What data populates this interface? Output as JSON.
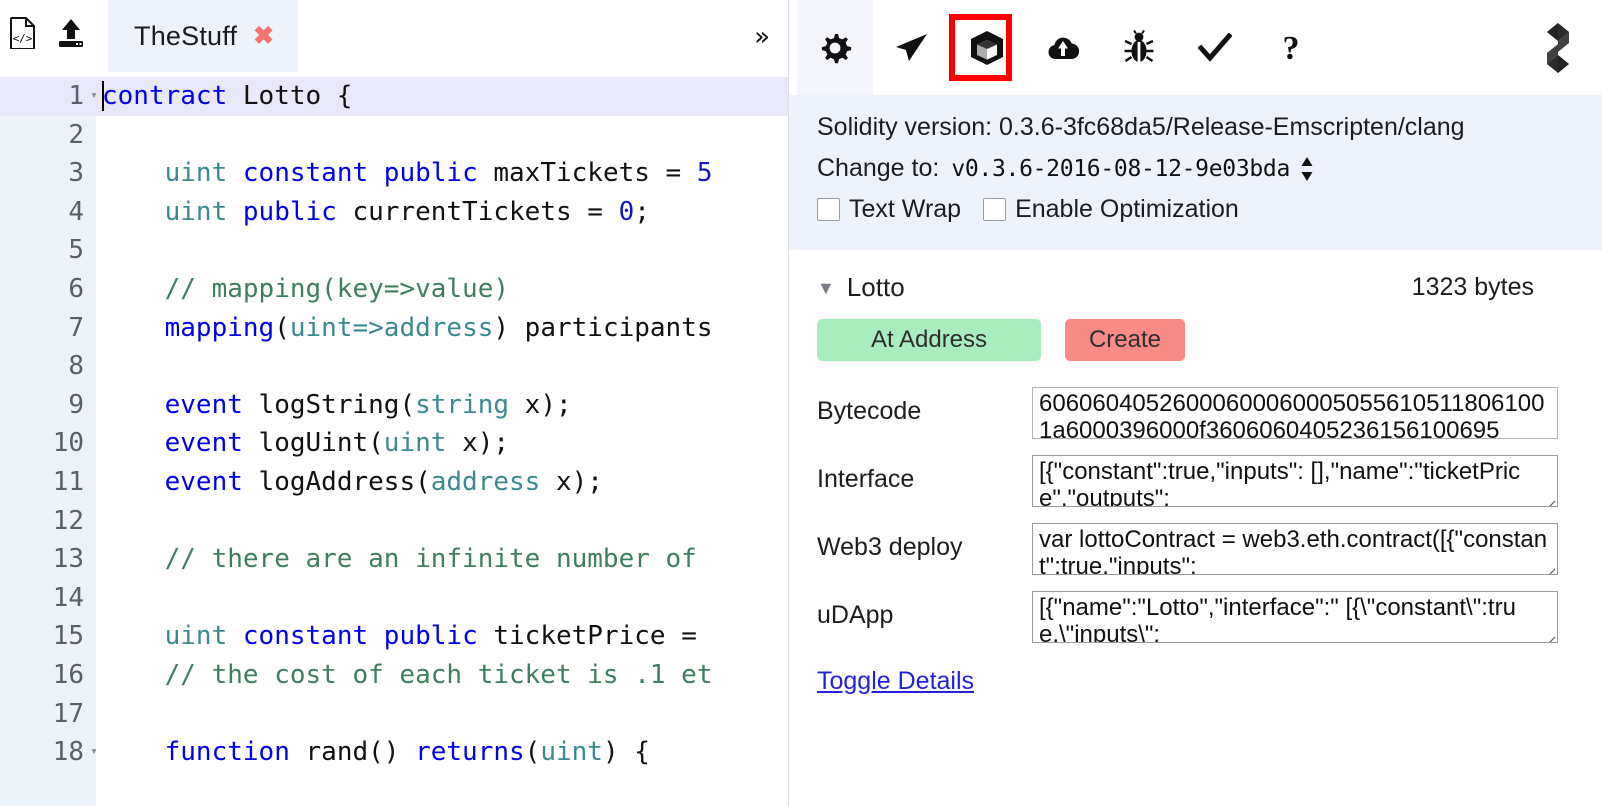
{
  "editor": {
    "toolbar": {
      "new_file_icon": "file-code-icon",
      "upload_icon": "upload-icon",
      "overflow_label": "»"
    },
    "tab": {
      "label": "TheStuff",
      "close_label": "✖"
    },
    "code": [
      {
        "num": "1",
        "fold": true,
        "active": true,
        "tokens": [
          {
            "t": "contract",
            "c": "kw"
          },
          {
            "t": " Lotto {",
            "c": "pln"
          }
        ]
      },
      {
        "num": "2",
        "fold": false,
        "active": false,
        "tokens": []
      },
      {
        "num": "3",
        "fold": false,
        "active": false,
        "tokens": [
          {
            "t": "    ",
            "c": "pln"
          },
          {
            "t": "uint",
            "c": "type"
          },
          {
            "t": " ",
            "c": "pln"
          },
          {
            "t": "constant",
            "c": "kw"
          },
          {
            "t": " ",
            "c": "pln"
          },
          {
            "t": "public",
            "c": "kw"
          },
          {
            "t": " maxTickets = ",
            "c": "pln"
          },
          {
            "t": "5",
            "c": "num"
          }
        ]
      },
      {
        "num": "4",
        "fold": false,
        "active": false,
        "tokens": [
          {
            "t": "    ",
            "c": "pln"
          },
          {
            "t": "uint",
            "c": "type"
          },
          {
            "t": " ",
            "c": "pln"
          },
          {
            "t": "public",
            "c": "kw"
          },
          {
            "t": " currentTickets = ",
            "c": "pln"
          },
          {
            "t": "0",
            "c": "num"
          },
          {
            "t": ";",
            "c": "pln"
          }
        ]
      },
      {
        "num": "5",
        "fold": false,
        "active": false,
        "tokens": []
      },
      {
        "num": "6",
        "fold": false,
        "active": false,
        "tokens": [
          {
            "t": "    ",
            "c": "pln"
          },
          {
            "t": "// mapping(key=>value)",
            "c": "com"
          }
        ]
      },
      {
        "num": "7",
        "fold": false,
        "active": false,
        "tokens": [
          {
            "t": "    ",
            "c": "pln"
          },
          {
            "t": "mapping",
            "c": "kw"
          },
          {
            "t": "(",
            "c": "pln"
          },
          {
            "t": "uint",
            "c": "type"
          },
          {
            "t": "=>",
            "c": "type"
          },
          {
            "t": "address",
            "c": "type"
          },
          {
            "t": ") participants",
            "c": "pln"
          }
        ]
      },
      {
        "num": "8",
        "fold": false,
        "active": false,
        "tokens": []
      },
      {
        "num": "9",
        "fold": false,
        "active": false,
        "tokens": [
          {
            "t": "    ",
            "c": "pln"
          },
          {
            "t": "event",
            "c": "kw"
          },
          {
            "t": " logString(",
            "c": "pln"
          },
          {
            "t": "string",
            "c": "type"
          },
          {
            "t": " x);",
            "c": "pln"
          }
        ]
      },
      {
        "num": "10",
        "fold": false,
        "active": false,
        "tokens": [
          {
            "t": "    ",
            "c": "pln"
          },
          {
            "t": "event",
            "c": "kw"
          },
          {
            "t": " logUint(",
            "c": "pln"
          },
          {
            "t": "uint",
            "c": "type"
          },
          {
            "t": " x);",
            "c": "pln"
          }
        ]
      },
      {
        "num": "11",
        "fold": false,
        "active": false,
        "tokens": [
          {
            "t": "    ",
            "c": "pln"
          },
          {
            "t": "event",
            "c": "kw"
          },
          {
            "t": " logAddress(",
            "c": "pln"
          },
          {
            "t": "address",
            "c": "type"
          },
          {
            "t": " x);",
            "c": "pln"
          }
        ]
      },
      {
        "num": "12",
        "fold": false,
        "active": false,
        "tokens": []
      },
      {
        "num": "13",
        "fold": false,
        "active": false,
        "tokens": [
          {
            "t": "    ",
            "c": "pln"
          },
          {
            "t": "// there are an infinite number of",
            "c": "com"
          }
        ]
      },
      {
        "num": "14",
        "fold": false,
        "active": false,
        "tokens": []
      },
      {
        "num": "15",
        "fold": false,
        "active": false,
        "tokens": [
          {
            "t": "    ",
            "c": "pln"
          },
          {
            "t": "uint",
            "c": "type"
          },
          {
            "t": " ",
            "c": "pln"
          },
          {
            "t": "constant",
            "c": "kw"
          },
          {
            "t": " ",
            "c": "pln"
          },
          {
            "t": "public",
            "c": "kw"
          },
          {
            "t": " ticketPrice = ",
            "c": "pln"
          }
        ]
      },
      {
        "num": "16",
        "fold": false,
        "active": false,
        "tokens": [
          {
            "t": "    ",
            "c": "pln"
          },
          {
            "t": "// the cost of each ticket is .1 et",
            "c": "com"
          }
        ]
      },
      {
        "num": "17",
        "fold": false,
        "active": false,
        "tokens": []
      },
      {
        "num": "18",
        "fold": true,
        "active": false,
        "tokens": [
          {
            "t": "    ",
            "c": "pln"
          },
          {
            "t": "function",
            "c": "kw"
          },
          {
            "t": " rand() ",
            "c": "pln"
          },
          {
            "t": "returns",
            "c": "kw"
          },
          {
            "t": "(",
            "c": "pln"
          },
          {
            "t": "uint",
            "c": "type"
          },
          {
            "t": ") {",
            "c": "pln"
          }
        ]
      }
    ]
  },
  "panel": {
    "tabs": [
      {
        "name": "settings",
        "icon": "gear-icon",
        "active": true
      },
      {
        "name": "run",
        "icon": "paper-plane-icon",
        "active": false
      },
      {
        "name": "compile",
        "icon": "cube-icon",
        "active": false,
        "highlighted": true
      },
      {
        "name": "publish",
        "icon": "cloud-upload-icon",
        "active": false
      },
      {
        "name": "debugger",
        "icon": "bug-icon",
        "active": false
      },
      {
        "name": "analysis",
        "icon": "check-icon",
        "active": false
      },
      {
        "name": "support",
        "icon": "question-icon",
        "active": false
      }
    ],
    "logo_icon": "solidity-logo-icon",
    "settings": {
      "solidity_version": "Solidity version: 0.3.6-3fc68da5/Release-Emscripten/clang",
      "change_to_label": "Change to:",
      "version_value": "v0.3.6-2016-08-12-9e03bda",
      "text_wrap_label": "Text Wrap",
      "optimization_label": "Enable Optimization",
      "text_wrap_checked": false,
      "optimization_checked": false
    },
    "contract": {
      "caret": "▼",
      "name": "Lotto",
      "size": "1323 bytes",
      "at_address_label": "At Address",
      "create_label": "Create",
      "at_address_color": "#a9ecc0",
      "create_color": "#f98a84",
      "details": [
        {
          "label": "Bytecode",
          "value": "60606040526000600060005055610511806100 1a6000396000f3606060405236156100695"
        },
        {
          "label": "Interface",
          "value": "[{\"constant\":true,\"inputs\": [],\"name\":\"ticketPrice\",\"outputs\":"
        },
        {
          "label": "Web3 deploy",
          "value": "var lottoContract = web3.eth.contract([{\"constant\":true,\"inputs\":"
        },
        {
          "label": "uDApp",
          "value": "[{\"name\":\"Lotto\",\"interface\":\" [{\\\"constant\\\":true,\\\"inputs\\\":"
        }
      ],
      "toggle_details_label": "Toggle Details"
    }
  }
}
